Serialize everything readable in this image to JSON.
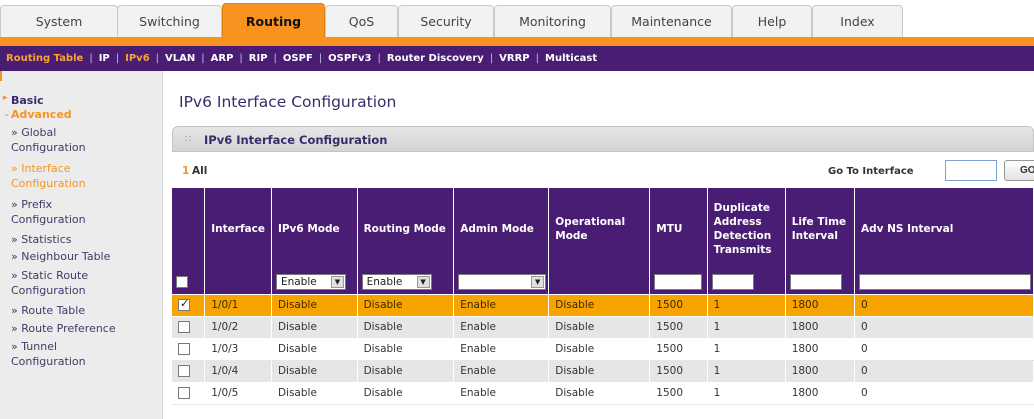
{
  "top_tabs": [
    {
      "label": "System"
    },
    {
      "label": "Switching"
    },
    {
      "label": "Routing"
    },
    {
      "label": "QoS"
    },
    {
      "label": "Security"
    },
    {
      "label": "Monitoring"
    },
    {
      "label": "Maintenance"
    },
    {
      "label": "Help"
    },
    {
      "label": "Index"
    }
  ],
  "subnav": [
    "Routing Table",
    "IP",
    "IPv6",
    "VLAN",
    "ARP",
    "RIP",
    "OSPF",
    "OSPFv3",
    "Router Discovery",
    "VRRP",
    "Multicast"
  ],
  "sidebar": {
    "basic": "Basic",
    "advanced": "Advanced",
    "items": [
      {
        "line1": "» Global",
        "line2": "Configuration"
      },
      {
        "line1": "» Interface",
        "line2": "Configuration"
      },
      {
        "line1": "» Prefix",
        "line2": "Configuration"
      },
      {
        "line1": "» Statistics",
        "line2": ""
      },
      {
        "line1": "» Neighbour Table",
        "line2": ""
      },
      {
        "line1": "» Static Route",
        "line2": "Configuration"
      },
      {
        "line1": "» Route Table",
        "line2": ""
      },
      {
        "line1": "» Route Preference",
        "line2": ""
      },
      {
        "line1": "» Tunnel",
        "line2": "Configuration"
      }
    ]
  },
  "page_title": "IPv6 Interface Configuration",
  "panel_title": "IPv6 Interface Configuration",
  "pagination": {
    "current": "1",
    "all": "All"
  },
  "goto": {
    "label": "Go To Interface",
    "button": "GO"
  },
  "columns": [
    "",
    "Interface",
    "IPv6 Mode",
    "Routing Mode",
    "Admin Mode",
    "Operational Mode",
    "MTU",
    "Duplicate Address Detection Transmits",
    "Life Time Interval",
    "Adv NS Interval"
  ],
  "filter": {
    "ipv6_mode": "Enable",
    "routing_mode": "Enable",
    "admin_mode": ""
  },
  "rows": [
    {
      "interface": "1/0/1",
      "ipv6_mode": "Disable",
      "routing_mode": "Disable",
      "admin_mode": "Enable",
      "operational_mode": "Disable",
      "mtu": "1500",
      "dad": "1",
      "life_time": "1800",
      "adv_ns": "0",
      "checked": true
    },
    {
      "interface": "1/0/2",
      "ipv6_mode": "Disable",
      "routing_mode": "Disable",
      "admin_mode": "Enable",
      "operational_mode": "Disable",
      "mtu": "1500",
      "dad": "1",
      "life_time": "1800",
      "adv_ns": "0",
      "checked": false
    },
    {
      "interface": "1/0/3",
      "ipv6_mode": "Disable",
      "routing_mode": "Disable",
      "admin_mode": "Enable",
      "operational_mode": "Disable",
      "mtu": "1500",
      "dad": "1",
      "life_time": "1800",
      "adv_ns": "0",
      "checked": false
    },
    {
      "interface": "1/0/4",
      "ipv6_mode": "Disable",
      "routing_mode": "Disable",
      "admin_mode": "Enable",
      "operational_mode": "Disable",
      "mtu": "1500",
      "dad": "1",
      "life_time": "1800",
      "adv_ns": "0",
      "checked": false
    },
    {
      "interface": "1/0/5",
      "ipv6_mode": "Disable",
      "routing_mode": "Disable",
      "admin_mode": "Enable",
      "operational_mode": "Disable",
      "mtu": "1500",
      "dad": "1",
      "life_time": "1800",
      "adv_ns": "0",
      "checked": false
    }
  ],
  "colors": {
    "accent": "#f7931e",
    "nav": "#4a1d75",
    "selected_row": "#f7a400"
  }
}
